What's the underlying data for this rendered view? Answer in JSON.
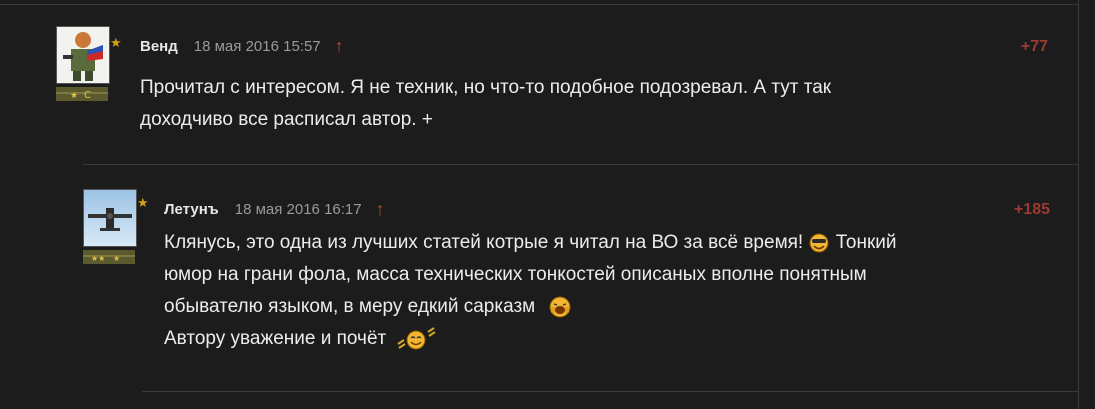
{
  "comments": [
    {
      "author": "Венд",
      "date": "18 мая 2016 15:57",
      "score": "+77",
      "text_lines": [
        "Прочитал с интересом. Я не техник, но что-то подобное подозревал. А тут так",
        "доходчиво все расписал автор. +"
      ],
      "rank_letter": "C"
    },
    {
      "author": "Летунъ",
      "date": "18 мая 2016 16:17",
      "score": "+185",
      "line1": "Клянусь, это одна из лучших статей котрые я читал на ВО за всё время!",
      "line1b": " Тонкий",
      "line2": "юмор на грани фола, масса технических тонкостей описаных вполне понятным",
      "line3": "обывателю языком, в меру едкий сарказм",
      "line4": "Автору уважение и почёт"
    }
  ],
  "colors": {
    "background": "#1c1c1c",
    "score": "#9b3b33",
    "arrow": "#b24a3a",
    "star": "#d4a017"
  }
}
